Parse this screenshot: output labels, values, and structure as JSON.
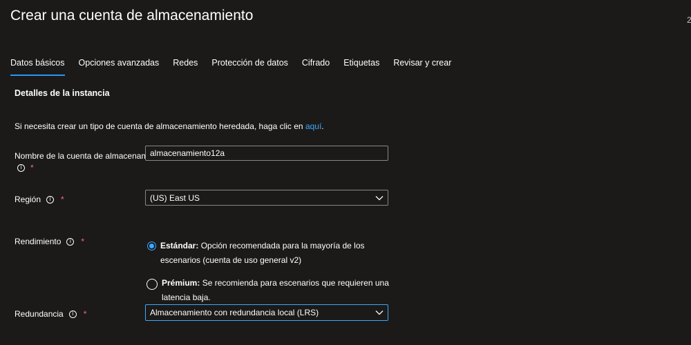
{
  "header": {
    "title": "Crear una cuenta de almacenamiento",
    "more_label": "...",
    "edge_text": "2"
  },
  "tabs": [
    {
      "label": "Datos básicos",
      "active": true
    },
    {
      "label": "Opciones avanzadas",
      "active": false
    },
    {
      "label": "Redes",
      "active": false
    },
    {
      "label": "Protección de datos",
      "active": false
    },
    {
      "label": "Cifrado",
      "active": false
    },
    {
      "label": "Etiquetas",
      "active": false
    },
    {
      "label": "Revisar y crear",
      "active": false
    }
  ],
  "section": {
    "title": "Detalles de la instancia",
    "note_prefix": "Si necesita crear un tipo de cuenta de almacenamiento heredada, haga clic en ",
    "note_link": "aquí",
    "note_suffix": "."
  },
  "fields": {
    "account_name": {
      "label_line1": "Nombre de la cuenta de almacenamiento",
      "value": "almacenamiento12a"
    },
    "region": {
      "label": "Región",
      "value": "(US) East US"
    },
    "performance": {
      "label": "Rendimiento",
      "standard_title": "Estándar:",
      "standard_desc": " Opción recomendada para la mayoría de los escenarios (cuenta de uso general v2)",
      "premium_title": "Prémium:",
      "premium_desc": " Se recomienda para escenarios que requieren una latencia baja.",
      "selected": "standard"
    },
    "redundancy": {
      "label": "Redundancia",
      "value": "Almacenamiento con redundancia local (LRS)"
    }
  },
  "common": {
    "info_glyph": "i",
    "required_mark": "*"
  },
  "colors": {
    "background": "#1b1a19",
    "accent": "#3ca9ff",
    "required": "#f1707b",
    "tab_underline": "#2899f5"
  }
}
